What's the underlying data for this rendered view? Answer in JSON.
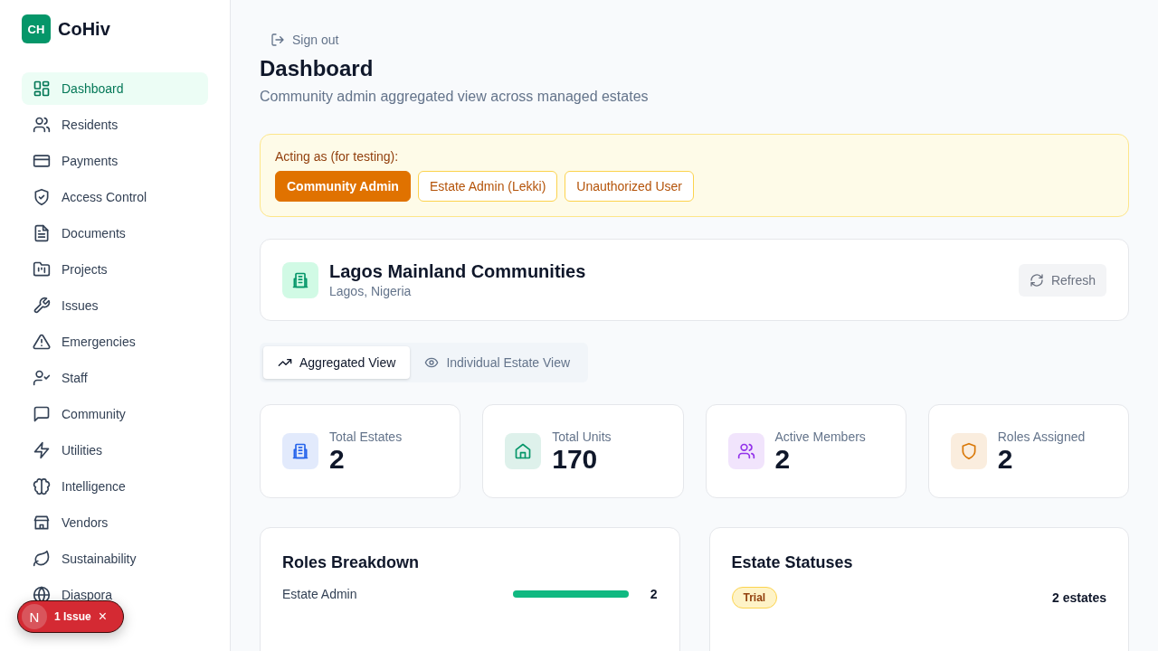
{
  "sidebar": {
    "logo": "CH",
    "brand": "CoHiv",
    "items": [
      {
        "label": "Dashboard",
        "selected": true
      },
      {
        "label": "Residents",
        "selected": false
      },
      {
        "label": "Payments",
        "selected": false
      },
      {
        "label": "Access Control",
        "selected": false
      },
      {
        "label": "Documents",
        "selected": false
      },
      {
        "label": "Projects",
        "selected": false
      },
      {
        "label": "Issues",
        "selected": false
      },
      {
        "label": "Emergencies",
        "selected": false
      },
      {
        "label": "Staff",
        "selected": false
      },
      {
        "label": "Community",
        "selected": false
      },
      {
        "label": "Utilities",
        "selected": false
      },
      {
        "label": "Intelligence",
        "selected": false
      },
      {
        "label": "Vendors",
        "selected": false
      },
      {
        "label": "Sustainability",
        "selected": false
      },
      {
        "label": "Diaspora",
        "selected": false
      }
    ]
  },
  "issue_badge": {
    "letter": "N",
    "label": "1 Issue",
    "close": "×"
  },
  "header": {
    "sign_out": "Sign out",
    "title": "Dashboard",
    "subtitle": "Community admin aggregated view across managed estates"
  },
  "acting_as": {
    "label": "Acting as (for testing):",
    "roles": [
      {
        "label": "Community Admin",
        "selected": true
      },
      {
        "label": "Estate Admin (Lekki)",
        "selected": false
      },
      {
        "label": "Unauthorized User",
        "selected": false
      }
    ]
  },
  "community": {
    "name": "Lagos Mainland Communities",
    "location": "Lagos, Nigeria",
    "refresh": "Refresh"
  },
  "view_tabs": [
    {
      "label": "Aggregated View",
      "selected": true
    },
    {
      "label": "Individual Estate View",
      "selected": false
    }
  ],
  "stats": [
    {
      "label": "Total Estates",
      "value": "2",
      "color": "#2563eb"
    },
    {
      "label": "Total Units",
      "value": "170",
      "color": "#059669"
    },
    {
      "label": "Active Members",
      "value": "2",
      "color": "#9333ea"
    },
    {
      "label": "Roles Assigned",
      "value": "2",
      "color": "#d97706"
    }
  ],
  "roles_breakdown": {
    "title": "Roles Breakdown",
    "rows": [
      {
        "label": "Estate Admin",
        "level": 1,
        "count": "2"
      }
    ]
  },
  "estate_statuses": {
    "title": "Estate Statuses",
    "rows": [
      {
        "status": "Trial",
        "count": "2 estates"
      }
    ]
  }
}
